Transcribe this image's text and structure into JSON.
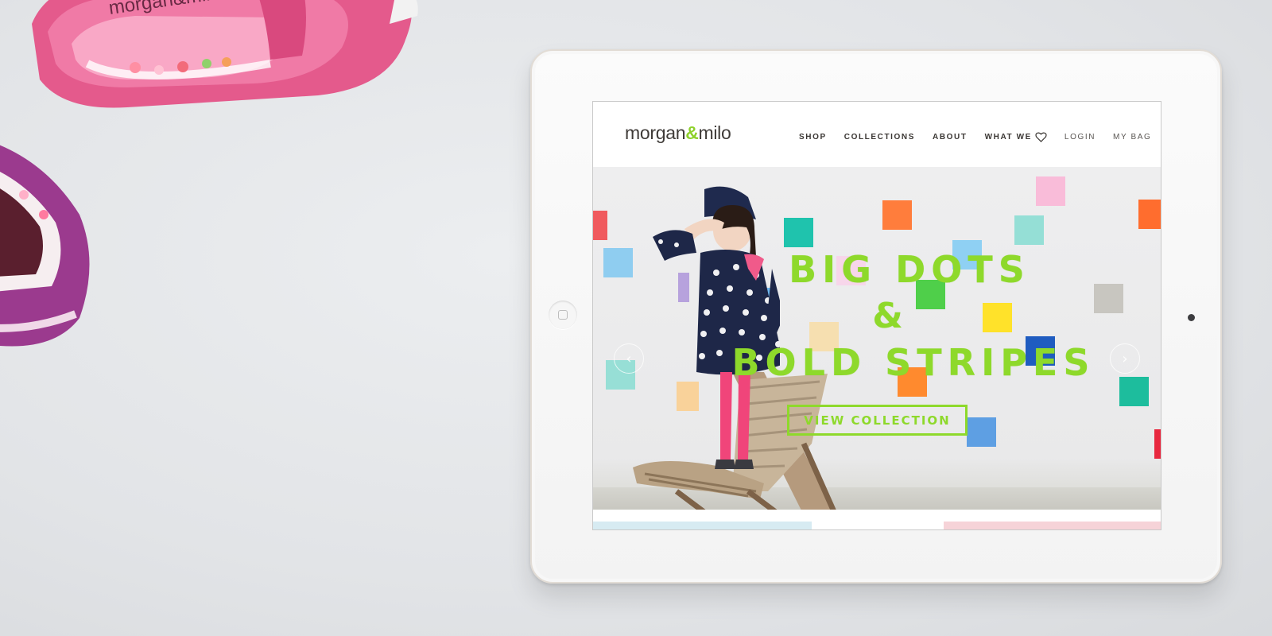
{
  "brand": {
    "logo_left": "morgan",
    "logo_amp": "&",
    "logo_right": "milo",
    "accent_color": "#8ed92b"
  },
  "nav": {
    "items": [
      {
        "label": "SHOP"
      },
      {
        "label": "COLLECTIONS"
      },
      {
        "label": "ABOUT"
      },
      {
        "label": "WHAT WE",
        "icon": "heart-icon"
      },
      {
        "label": "LOGIN"
      },
      {
        "label": "MY BAG"
      }
    ]
  },
  "hero": {
    "line1": "BIG DOTS",
    "line2": "&",
    "line3": "BOLD STRIPES",
    "cta_label": "VIEW COLLECTION",
    "prev_icon": "chevron-left-icon",
    "next_icon": "chevron-right-icon",
    "prev_glyph": "‹",
    "next_glyph": "›"
  },
  "device": {
    "home_button_icon": "home-square-icon"
  },
  "decor": {
    "shoe_logo_text": "morgan&milo"
  }
}
